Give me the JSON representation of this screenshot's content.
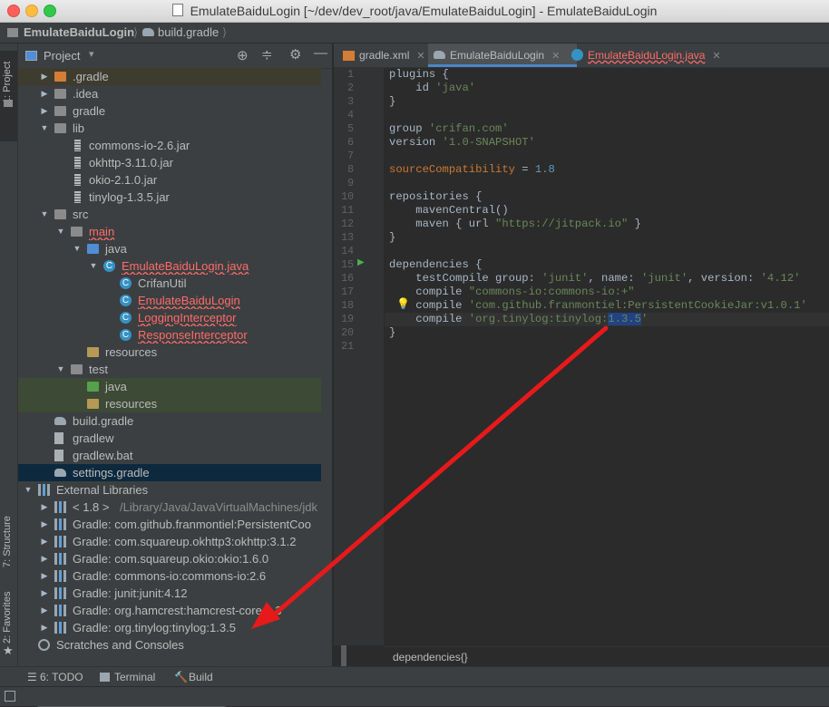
{
  "window": {
    "title": "EmulateBaiduLogin [~/dev/dev_root/java/EmulateBaiduLogin] - EmulateBaiduLogin"
  },
  "navbar": {
    "project": "EmulateBaiduLogin",
    "file": "build.gradle"
  },
  "left_stripe": {
    "project_tab": "1: Project",
    "structure_tab": "7: Structure",
    "favorites_tab": "2: Favorites"
  },
  "project_panel": {
    "title": "Project",
    "tree": [
      {
        "label": ".gradle",
        "icon": "folder-orange-icon",
        "arrow": "collapsed"
      },
      {
        "label": ".idea",
        "icon": "folder-icon",
        "arrow": "collapsed"
      },
      {
        "label": "gradle",
        "icon": "folder-icon",
        "arrow": "collapsed"
      },
      {
        "label": "lib",
        "icon": "folder-icon",
        "arrow": "expanded"
      },
      {
        "label": "commons-io-2.6.jar",
        "icon": "jar-icon"
      },
      {
        "label": "okhttp-3.11.0.jar",
        "icon": "jar-icon"
      },
      {
        "label": "okio-2.1.0.jar",
        "icon": "jar-icon"
      },
      {
        "label": "tinylog-1.3.5.jar",
        "icon": "jar-icon"
      },
      {
        "label": "src",
        "icon": "folder-icon",
        "arrow": "expanded"
      },
      {
        "label": "main",
        "icon": "folder-icon",
        "arrow": "expanded"
      },
      {
        "label": "java",
        "icon": "folder-blue-icon",
        "arrow": "expanded"
      },
      {
        "label": "EmulateBaiduLogin.java",
        "icon": "java-class-icon",
        "arrow": "expanded"
      },
      {
        "label": "CrifanUtil",
        "icon": "class-icon"
      },
      {
        "label": "EmulateBaiduLogin",
        "icon": "class-icon"
      },
      {
        "label": "LoggingInterceptor",
        "icon": "class-icon"
      },
      {
        "label": "ResponseInterceptor",
        "icon": "class-icon"
      },
      {
        "label": "resources",
        "icon": "resources-folder-icon"
      },
      {
        "label": "test",
        "icon": "folder-icon",
        "arrow": "expanded"
      },
      {
        "label": "java",
        "icon": "folder-green-icon"
      },
      {
        "label": "resources",
        "icon": "resources-folder-icon"
      },
      {
        "label": "build.gradle",
        "icon": "gradle-icon"
      },
      {
        "label": "gradlew",
        "icon": "file-icon"
      },
      {
        "label": "gradlew.bat",
        "icon": "file-icon"
      },
      {
        "label": "settings.gradle",
        "icon": "gradle-icon"
      },
      {
        "label": "External Libraries",
        "icon": "library-icon",
        "arrow": "expanded"
      },
      {
        "label": "< 1.8 >",
        "extra": "/Library/Java/JavaVirtualMachines/jdk",
        "icon": "library-icon",
        "arrow": "collapsed"
      },
      {
        "label": "Gradle: com.github.franmontiel:PersistentCoo",
        "icon": "library-icon",
        "arrow": "collapsed"
      },
      {
        "label": "Gradle: com.squareup.okhttp3:okhttp:3.1.2",
        "icon": "library-icon",
        "arrow": "collapsed"
      },
      {
        "label": "Gradle: com.squareup.okio:okio:1.6.0",
        "icon": "library-icon",
        "arrow": "collapsed"
      },
      {
        "label": "Gradle: commons-io:commons-io:2.6",
        "icon": "library-icon",
        "arrow": "collapsed"
      },
      {
        "label": "Gradle: junit:junit:4.12",
        "icon": "library-icon",
        "arrow": "collapsed"
      },
      {
        "label": "Gradle: org.hamcrest:hamcrest-core:1.3",
        "icon": "library-icon",
        "arrow": "collapsed"
      },
      {
        "label": "Gradle: org.tinylog:tinylog:1.3.5",
        "icon": "library-icon",
        "arrow": "collapsed"
      },
      {
        "label": "Scratches and Consoles",
        "icon": "scratches-icon"
      }
    ]
  },
  "editor": {
    "tabs": [
      {
        "label": "gradle.xml"
      },
      {
        "label": "EmulateBaiduLogin"
      },
      {
        "label": "EmulateBaiduLogin.java"
      }
    ],
    "line_numbers": [
      "1",
      "2",
      "3",
      "4",
      "5",
      "6",
      "7",
      "8",
      "9",
      "10",
      "11",
      "12",
      "13",
      "14",
      "15",
      "16",
      "17",
      "18",
      "19",
      "20",
      "21"
    ],
    "code": {
      "l1a": "plugins {",
      "l2a": "    id ",
      "l2b": "'java'",
      "l3a": "}",
      "l5a": "group ",
      "l5b": "'crifan.com'",
      "l6a": "version ",
      "l6b": "'1.0-SNAPSHOT'",
      "l8a": "sourceCompatibility",
      "l8b": " = ",
      "l8c": "1.8",
      "l10a": "repositories {",
      "l11a": "    mavenCentral()",
      "l12a": "    maven { url ",
      "l12b": "\"https://jitpack.io\"",
      "l12c": " }",
      "l13a": "}",
      "l15a": "dependencies {",
      "l16a": "    testCompile group: ",
      "l16b": "'junit'",
      "l16c": ", name: ",
      "l16d": "'junit'",
      "l16e": ", version: ",
      "l16f": "'4.12'",
      "l17a": "    compile ",
      "l17b": "\"commons-io:commons-io:+\"",
      "l18a": "    compile ",
      "l18b": "'com.github.franmontiel:PersistentCookieJar:v1.0.1'",
      "l19a": "    compile ",
      "l19b": "'org.tinylog:tinylog:",
      "l19c": "1.3.5",
      "l19d": "'",
      "l20a": "}"
    },
    "breadcrumb": "dependencies{}"
  },
  "bottom_tools": {
    "todo": "6: TODO",
    "terminal": "Terminal",
    "build": "Build"
  },
  "colors": {
    "accent": "#4a88c7",
    "annotation_arrow": "#e8191b"
  }
}
